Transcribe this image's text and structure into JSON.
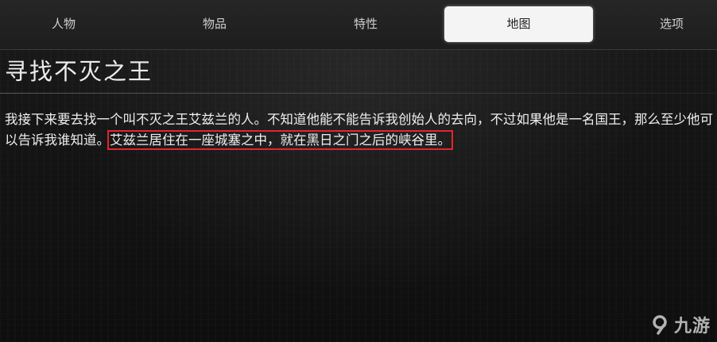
{
  "tabs": [
    {
      "label": "人物",
      "active": false
    },
    {
      "label": "物品",
      "active": false
    },
    {
      "label": "特性",
      "active": false
    },
    {
      "label": "地图",
      "active": true
    },
    {
      "label": "选项",
      "active": false
    }
  ],
  "quest": {
    "title": "寻找不灭之王",
    "description_part1": "我接下来要去找一个叫不灭之王艾兹兰的人。不知道他能不能告诉我创始人的去向，不过如果他是一名国王，那么至少他可以告诉我谁知道。",
    "description_highlight": "艾兹兰居住在一座城塞之中，就在黑日之门之后的峡谷里。"
  },
  "watermark": {
    "text": "九游",
    "icon": "jiuyou-logo-icon"
  },
  "colors": {
    "highlight_border": "#e3262c",
    "active_tab_bg": "#f4f4f4"
  }
}
